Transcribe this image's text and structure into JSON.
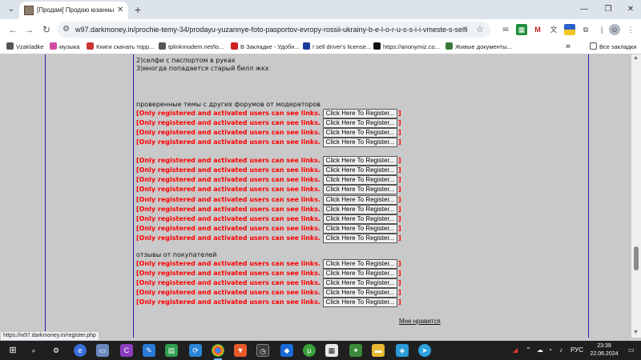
{
  "browser": {
    "tab_title": "[Продам] Продаю юзанные ф",
    "url": "w97.darkmoney.in/prochie-temy-34/prodayu-yuzannye-foto-pasportov-evropy-rossii-ukrainy-b-e-l-o-r-u-s-s-i-i-vmeste-s-selfi-smotrite...",
    "close_glyph": "✕",
    "new_tab_glyph": "+",
    "minimize_glyph": "—",
    "restore_glyph": "❐",
    "close_window_glyph": "✕"
  },
  "bookmarks": {
    "items": [
      {
        "label": "Vzakladke",
        "color": "#555555"
      },
      {
        "label": "музыка",
        "color": "#d04aa0"
      },
      {
        "label": "Книги скачать торр...",
        "color": "#cc3333"
      },
      {
        "label": "tplinkmodem.net/lo...",
        "color": "#555555"
      },
      {
        "label": "В Закладке - Удобн...",
        "color": "#cc2222"
      },
      {
        "label": "I sell driver's license...",
        "color": "#1a3a9a"
      },
      {
        "label": "https://anonymiz.co...",
        "color": "#111111"
      },
      {
        "label": "Живые документы...",
        "color": "#3a7a3a"
      }
    ],
    "more": "»",
    "all_bookmarks": "Все закладки"
  },
  "post": {
    "line1": "2)селфи с паспортом в руках",
    "line2": "3)иногда попадается старый билл жкх",
    "section1_heading": "проверенные темы с других форумов от модераторов",
    "section3_heading": "отзывы от покупателей",
    "link_text": "[Only registered and activated users can see links.",
    "button_label": "Click Here To Register...",
    "bracket_close": "]",
    "like_label": "Мне нравится"
  },
  "status_bar": {
    "url": "https://w97.darkmoney.in/register.php"
  },
  "taskbar": {
    "language": "РУС",
    "time": "23:39",
    "date": "22.06.2024"
  }
}
